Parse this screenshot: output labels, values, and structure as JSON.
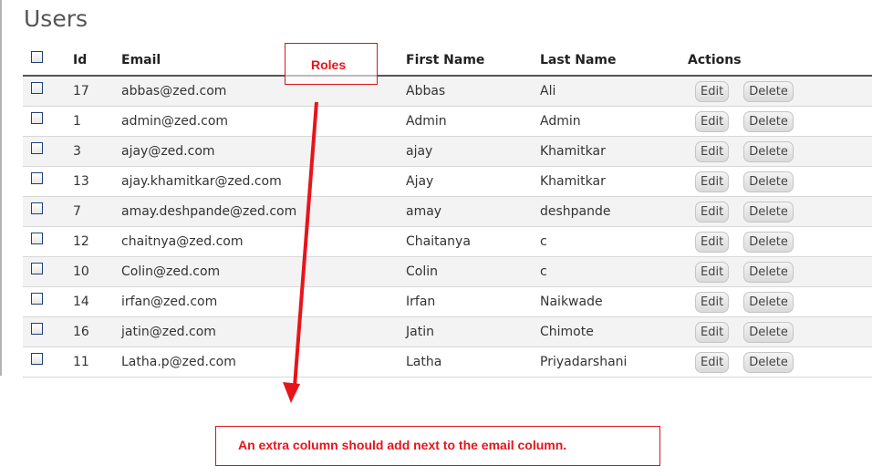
{
  "page": {
    "title": "Users"
  },
  "table": {
    "columns": [
      "Id",
      "Email",
      "First Name",
      "Last Name",
      "Actions"
    ],
    "rows": [
      {
        "id": "17",
        "email": "abbas@zed.com",
        "first": "Abbas",
        "last": "Ali"
      },
      {
        "id": "1",
        "email": "admin@zed.com",
        "first": "Admin",
        "last": "Admin"
      },
      {
        "id": "3",
        "email": "ajay@zed.com",
        "first": "ajay",
        "last": "Khamitkar"
      },
      {
        "id": "13",
        "email": "ajay.khamitkar@zed.com",
        "first": "Ajay",
        "last": "Khamitkar"
      },
      {
        "id": "7",
        "email": "amay.deshpande@zed.com",
        "first": "amay",
        "last": "deshpande"
      },
      {
        "id": "12",
        "email": "chaitnya@zed.com",
        "first": "Chaitanya",
        "last": "c"
      },
      {
        "id": "10",
        "email": "Colin@zed.com",
        "first": "Colin",
        "last": "c"
      },
      {
        "id": "14",
        "email": "irfan@zed.com",
        "first": "Irfan",
        "last": "Naikwade"
      },
      {
        "id": "16",
        "email": "jatin@zed.com",
        "first": "Jatin",
        "last": "Chimote"
      },
      {
        "id": "11",
        "email": "Latha.p@zed.com",
        "first": "Latha",
        "last": "Priyadarshani"
      }
    ],
    "edit_label": "Edit",
    "delete_label": "Delete"
  },
  "annotations": {
    "roles": "Roles",
    "note": "An extra column should add next to the email column.",
    "color": "#e8141b"
  }
}
